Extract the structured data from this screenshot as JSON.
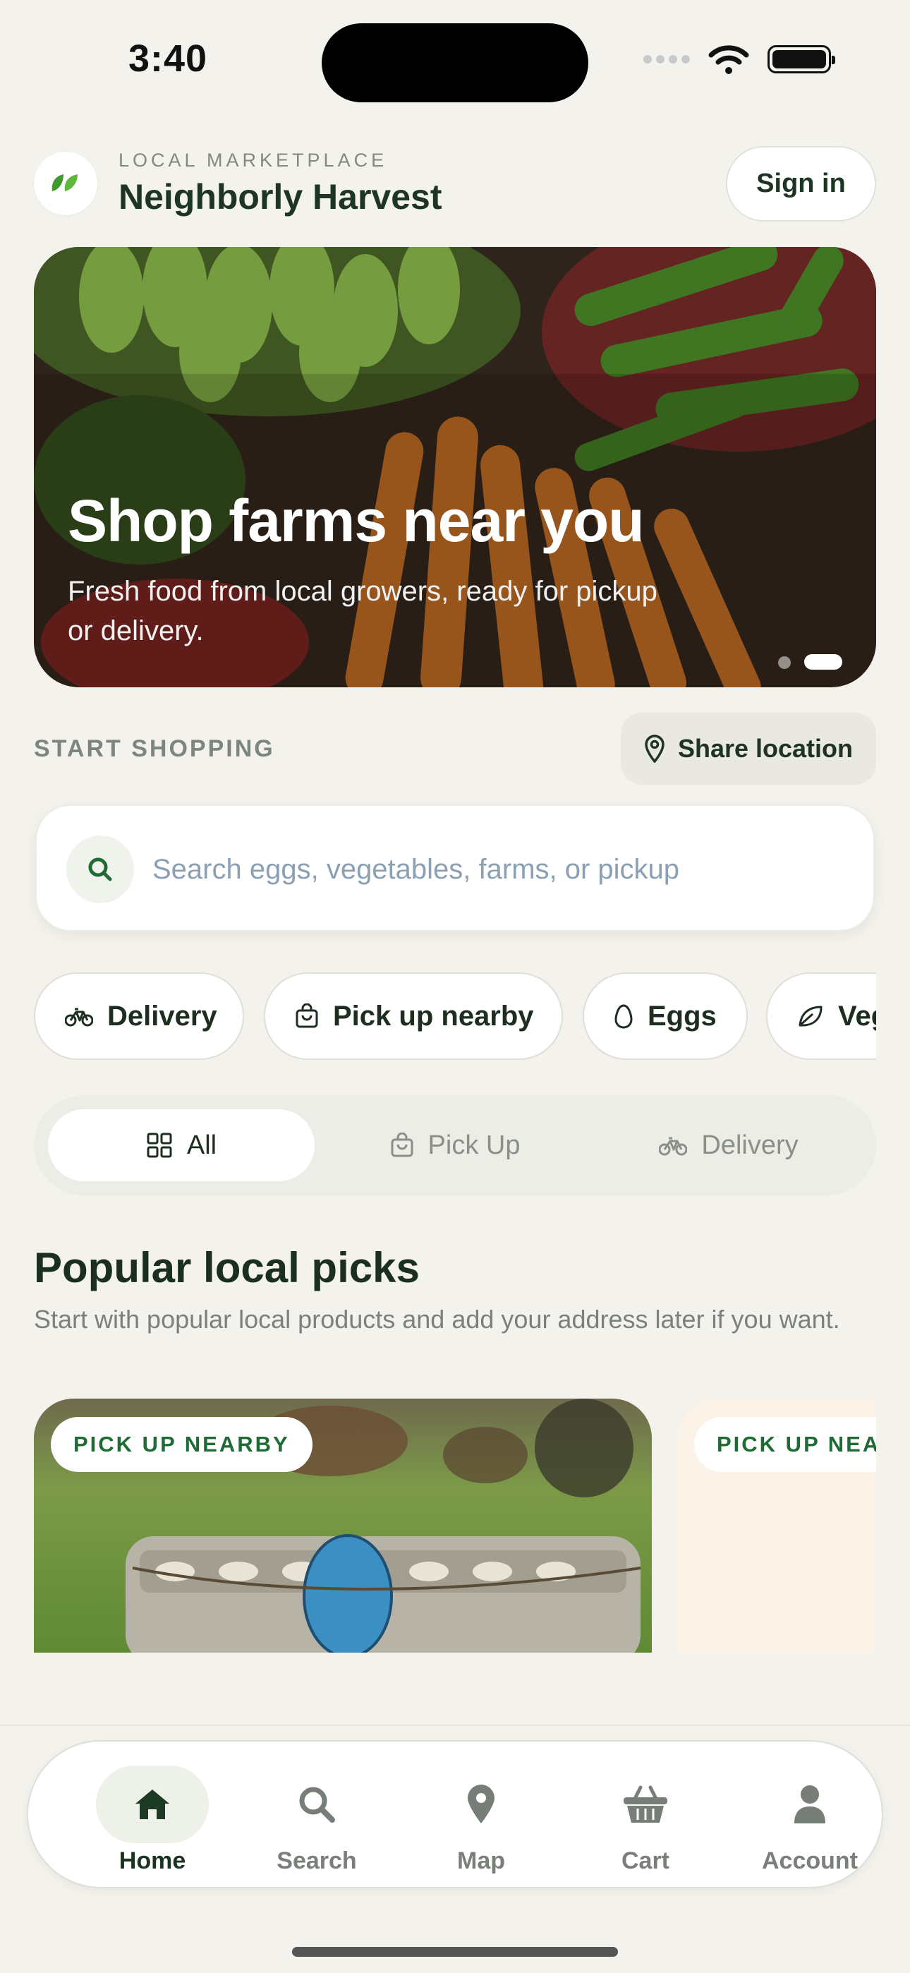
{
  "status": {
    "time": "3:40"
  },
  "header": {
    "eyebrow": "LOCAL MARKETPLACE",
    "title": "Neighborly Harvest",
    "sign_in": "Sign in"
  },
  "hero": {
    "title": "Shop farms near you",
    "subtitle": "Fresh food from local growers, ready for pickup or delivery.",
    "carousel_active": 2,
    "carousel_total": 2
  },
  "start": {
    "label": "START SHOPPING",
    "share_location": "Share location"
  },
  "search": {
    "placeholder": "Search eggs, vegetables, farms, or pickup",
    "icon": "search-icon"
  },
  "chips": [
    {
      "label": "Delivery",
      "icon": "bicycle-icon"
    },
    {
      "label": "Pick up nearby",
      "icon": "shopping-bag-icon"
    },
    {
      "label": "Eggs",
      "icon": "egg-icon"
    },
    {
      "label": "Vegetables",
      "icon": "leaf-icon"
    }
  ],
  "segments": [
    {
      "label": "All",
      "icon": "grid-icon",
      "active": true
    },
    {
      "label": "Pick Up",
      "icon": "shopping-bag-icon",
      "active": false
    },
    {
      "label": "Delivery",
      "icon": "bicycle-icon",
      "active": false
    }
  ],
  "popular": {
    "title": "Popular local picks",
    "subtitle": "Start with popular local products and add your address later if you want."
  },
  "cards": [
    {
      "badge": "PICK UP NEARBY"
    },
    {
      "badge": "PICK UP NEARBY"
    }
  ],
  "tabs": [
    {
      "label": "Home",
      "icon": "house-icon",
      "active": true
    },
    {
      "label": "Search",
      "icon": "search-icon",
      "active": false
    },
    {
      "label": "Map",
      "icon": "map-pin-icon",
      "active": false
    },
    {
      "label": "Cart",
      "icon": "basket-icon",
      "active": false
    },
    {
      "label": "Account",
      "icon": "person-icon",
      "active": false
    }
  ],
  "colors": {
    "accent": "#1f6a35",
    "background": "#f4f2ec",
    "text": "#1d3522"
  }
}
